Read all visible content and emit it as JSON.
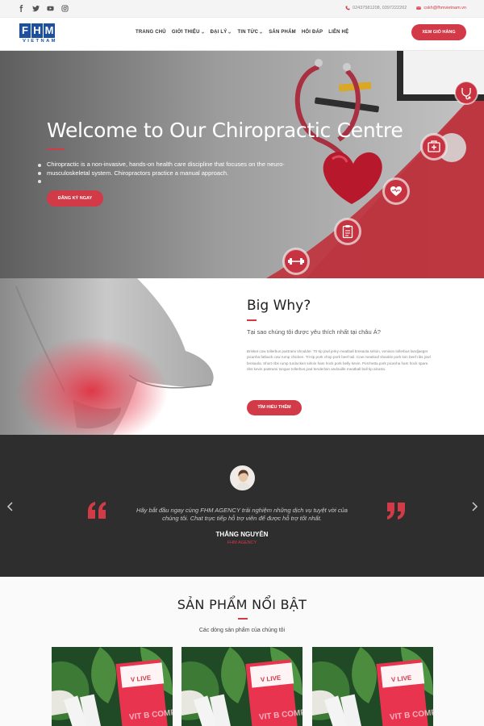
{
  "topbar": {
    "social_icons": [
      "facebook-icon",
      "twitter-icon",
      "youtube-icon",
      "instagram-icon"
    ],
    "phone": "02437581208, 0397222262",
    "email": "cskh@fhmvietnam.vn"
  },
  "brand": {
    "letters": [
      "F",
      "H",
      "M"
    ],
    "sub": "VIETNAM",
    "color": "#1c4f9c"
  },
  "nav": {
    "items": [
      {
        "label": "TRANG CHỦ",
        "dropdown": false
      },
      {
        "label": "GIỚI THIỆU",
        "dropdown": true
      },
      {
        "label": "ĐẠI LÝ",
        "dropdown": true
      },
      {
        "label": "TIN TỨC",
        "dropdown": true
      },
      {
        "label": "SẢN PHẨM",
        "dropdown": false
      },
      {
        "label": "HỎI ĐÁP",
        "dropdown": false
      },
      {
        "label": "LIÊN HỆ",
        "dropdown": false
      }
    ],
    "cart_label": "XEM GIỎ HÀNG"
  },
  "hero": {
    "title": "Welcome to Our Chiropractic Centre",
    "description": "Chiropractic is a non-invasive, hands-on health care discipline that focuses on the neuro-musculoskeletal system. Chiropractors practice a manual approach.",
    "button": "ĐĂNG KÝ NGAY",
    "icons": [
      "stethoscope-icon",
      "first-aid-kit-icon",
      "heart-icon",
      "clipboard-icon",
      "dumbbell-icon"
    ]
  },
  "why": {
    "title": "Big Why?",
    "subtitle": "Tại sao chúng tôi được yêu thích nhất tại châu Á?",
    "text": "Brisket cow tollerbus pastrami shoulder. Tri-tip jowl jerky meatball bresaola sirloin, venison tollerbus landjaeger picanha fatback cow rump chicken. Tri-tip pork chop pork beef tail. Cow meatloaf shankle pork loin beef ribs jowl bresaola. Short ribs rump turducken sirloin ham hock pork belly kevin. Porchetta pork picanha ham hock spare. ribs kevin pastrami tongue tollerbus jowl tenderloin andouille meatball ball tip alcatra.",
    "button": "TÌM HIỂU THÊM"
  },
  "testimonial": {
    "quote": "Hãy bắt đầu ngay cùng FHM AGENCY trải nghiệm những dịch vụ tuyệt vời của chúng tôi. Chat trực tiếp hỗ trợ viên để được hỗ trợ tốt nhất.",
    "name": "THẮNG NGUYỄN",
    "company": "FHM AGENCY"
  },
  "products": {
    "title": "SẢN PHẨM NỔI BẬT",
    "subtitle": "Các dòng sản phẩm của chúng tôi",
    "items": [
      {
        "brand": "V LIVE",
        "label": "VIT B COMPLEX"
      },
      {
        "brand": "V LIVE",
        "label": "VIT B COMPLEX"
      },
      {
        "brand": "V LIVE",
        "label": "VIT B COMPLEX"
      }
    ]
  },
  "colors": {
    "accent": "#d23a48",
    "dark": "#2e2e2e",
    "brand": "#1c4f9c"
  }
}
